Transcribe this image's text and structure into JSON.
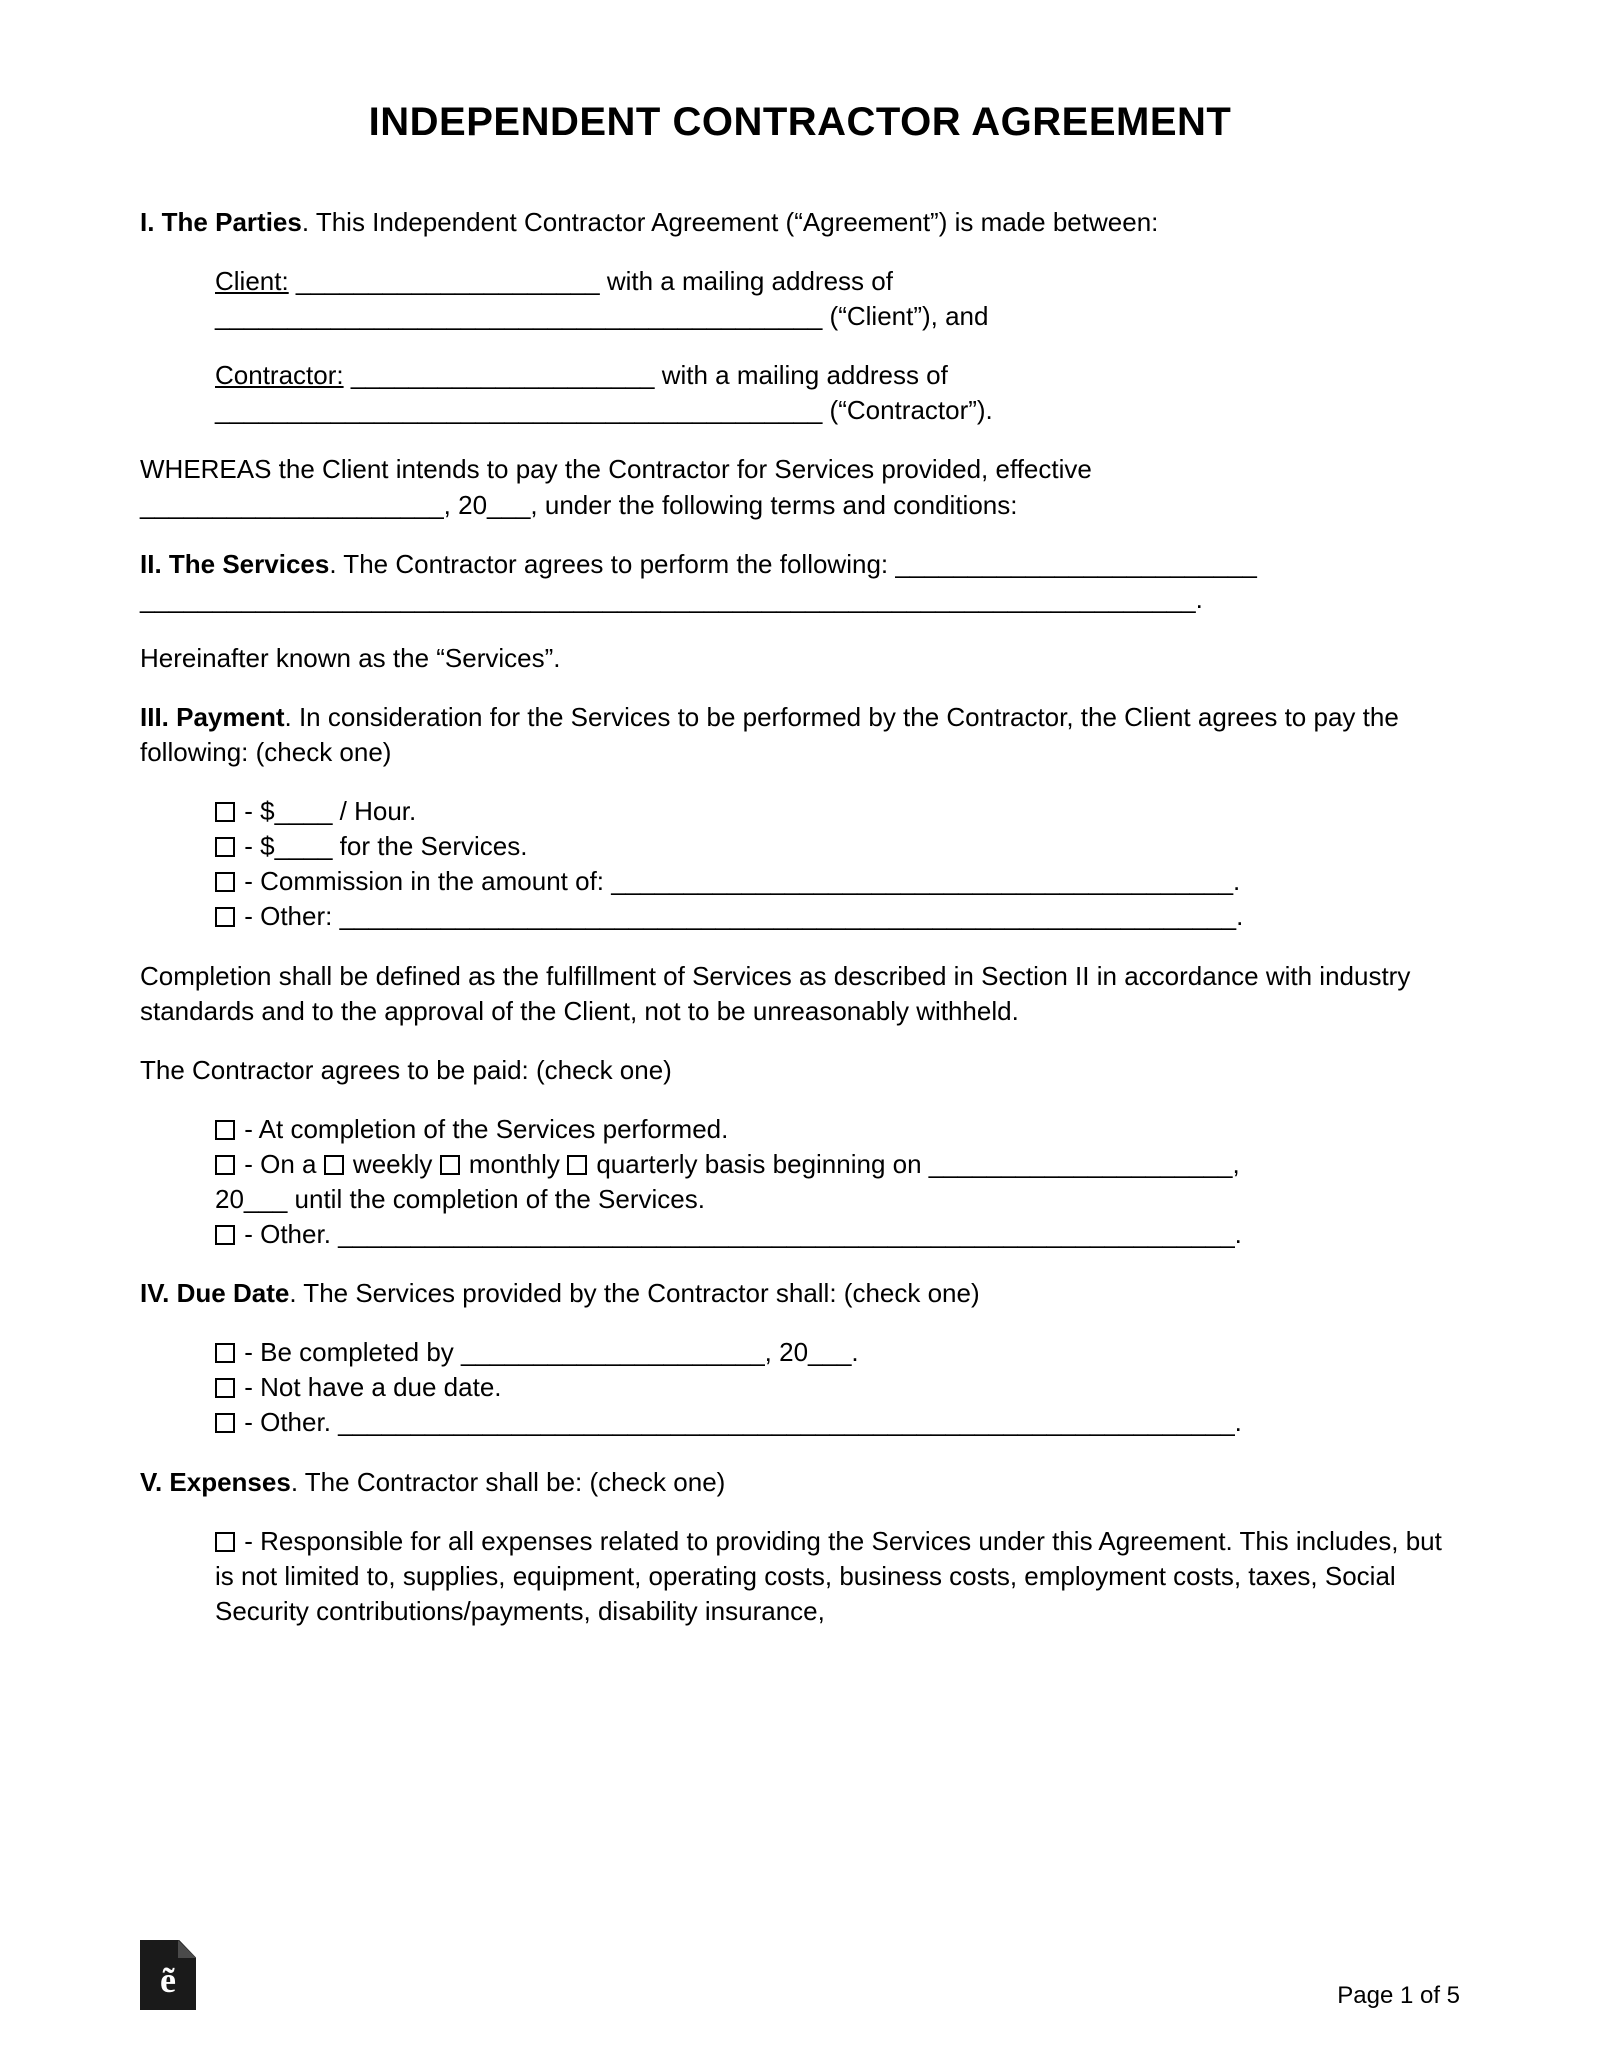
{
  "title": "INDEPENDENT CONTRACTOR AGREEMENT",
  "s1": {
    "heading": "I. The Parties",
    "intro": ". This Independent Contractor Agreement (“Agreement”) is made between:",
    "client_label": "Client:",
    "client_blank": " _____________________ ",
    "client_mail": "with a mailing address of",
    "client_addr_blank": "__________________________________________ ",
    "client_tag": "(“Client”), and",
    "contractor_label": "Contractor:",
    "contractor_blank": " _____________________ ",
    "contractor_mail": "with a mailing address of",
    "contractor_addr_blank": "__________________________________________ ",
    "contractor_tag": "(“Contractor”).",
    "whereas1": "WHEREAS the Client intends to pay the Contractor for Services provided, effective",
    "whereas2": "_____________________, 20___, under the following terms and conditions:"
  },
  "s2": {
    "heading": "II. The Services",
    "intro": ". The Contractor agrees to perform the following: _________________________",
    "line2": "_________________________________________________________________________.",
    "hereinafter": "Hereinafter known as the “Services”."
  },
  "s3": {
    "heading": "III. Payment",
    "intro": ". In consideration for the Services to be performed by the Contractor, the Client agrees to pay the following: (check one)",
    "opt1": " - $____ / Hour.",
    "opt2": " - $____ for the Services.",
    "opt3": " - Commission in the amount of: ___________________________________________.",
    "opt4": " - Other: ______________________________________________________________.",
    "completion": "Completion shall be defined as the fulfillment of Services as described in Section II in accordance with industry standards and to the approval of the Client, not to be unreasonably withheld.",
    "paid_intro": "The Contractor agrees to be paid: (check one)",
    "p1": " - At completion of the Services performed.",
    "p2a": " - On a ",
    "p2_weekly": " weekly ",
    "p2_monthly": " monthly ",
    "p2_quarterly": " quarterly basis beginning on _____________________,",
    "p2b": "20___ until the completion of the Services.",
    "p3": " - Other. ______________________________________________________________."
  },
  "s4": {
    "heading": "IV. Due Date",
    "intro": ". The Services provided by the Contractor shall: (check one)",
    "d1": " - Be completed by _____________________, 20___.",
    "d2": " - Not have a due date.",
    "d3": " - Other. ______________________________________________________________."
  },
  "s5": {
    "heading": "V. Expenses",
    "intro": ". The Contractor shall be: (check one)",
    "e1": " - Responsible for all expenses related to providing the Services under this Agreement. This includes, but is not limited to, supplies, equipment, operating costs, business costs, employment costs, taxes, Social Security contributions/payments, disability insurance,"
  },
  "footer": {
    "page": "Page 1 of 5",
    "logo_glyph": "e͂"
  }
}
